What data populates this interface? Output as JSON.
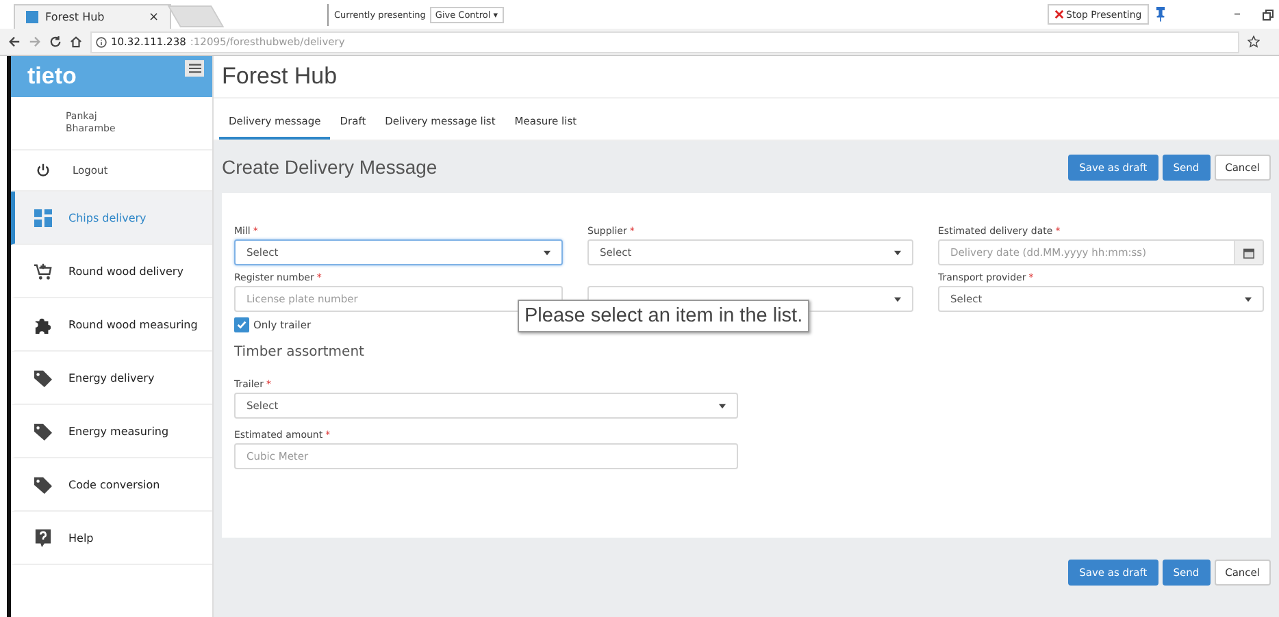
{
  "browser": {
    "tab_title": "Forest Hub",
    "tab_close": "×",
    "presenting": "Currently presenting",
    "give_control": "Give Control ▾",
    "stop_presenting": "Stop Presenting",
    "url_host": "10.32.111.238",
    "url_path": ":12095/foresthubweb/delivery",
    "window_minimize": "–"
  },
  "sidebar": {
    "logo": "tieto",
    "user": [
      "Pankaj",
      "Bharambe"
    ],
    "logout": "Logout",
    "items": [
      {
        "label": "Chips delivery",
        "kind": "chips",
        "selected": true
      },
      {
        "label": "Round wood delivery",
        "kind": "delivery",
        "selected": false
      },
      {
        "label": "Round wood measuring",
        "kind": "measuring",
        "selected": false
      },
      {
        "label": "Energy delivery",
        "kind": "energy",
        "selected": false
      },
      {
        "label": "Energy measuring",
        "kind": "energy",
        "selected": false
      },
      {
        "label": "Code conversion",
        "kind": "energy",
        "selected": false
      },
      {
        "label": "Help",
        "kind": "help",
        "selected": false
      }
    ]
  },
  "app_title": "Forest Hub",
  "tabs": [
    {
      "label": "Delivery message",
      "selected": true
    },
    {
      "label": "Draft",
      "selected": false
    },
    {
      "label": "Delivery message list",
      "selected": false
    },
    {
      "label": "Measure list",
      "selected": false
    }
  ],
  "page_title": "Create Delivery Message",
  "actions": [
    {
      "label": "Save as draft",
      "kind": "primary"
    },
    {
      "label": "Send",
      "kind": "primary"
    },
    {
      "label": "Cancel",
      "kind": "default"
    }
  ],
  "fields": [
    {
      "label": "Mill",
      "mark": "*",
      "kind": "select",
      "placeholder": "Select",
      "focused": true
    },
    {
      "label": "Supplier",
      "mark": "*",
      "kind": "select",
      "placeholder": "Select",
      "focused": false
    },
    {
      "label": "Estimated delivery date",
      "mark": "*",
      "kind": "date",
      "placeholder": "Delivery date (dd.MM.yyyy hh:mm:ss)",
      "focused": false
    },
    {
      "label": "Register number",
      "mark": "*",
      "kind": "text",
      "placeholder": "License plate number",
      "focused": false
    },
    {
      "kind": "select",
      "focused": false
    },
    {
      "label": "Transport provider",
      "mark": "*",
      "kind": "select",
      "placeholder": "Select",
      "focused": false
    }
  ],
  "only_trailer": {
    "label": "Only trailer",
    "checked": true
  },
  "section_title": "Timber assortment",
  "lower_fields": [
    {
      "label": "Trailer",
      "mark": "*",
      "kind": "select",
      "placeholder": "Select",
      "focused": false
    },
    {
      "label": "Estimated amount",
      "mark": "*",
      "kind": "text",
      "placeholder": "Cubic Meter",
      "focused": false
    }
  ],
  "tooltip": "Please select an item in the list.",
  "bottom_actions": [
    {
      "label": "Save as draft",
      "kind": "primary"
    },
    {
      "label": "Send",
      "kind": "primary"
    },
    {
      "label": "Cancel",
      "kind": "default"
    }
  ]
}
